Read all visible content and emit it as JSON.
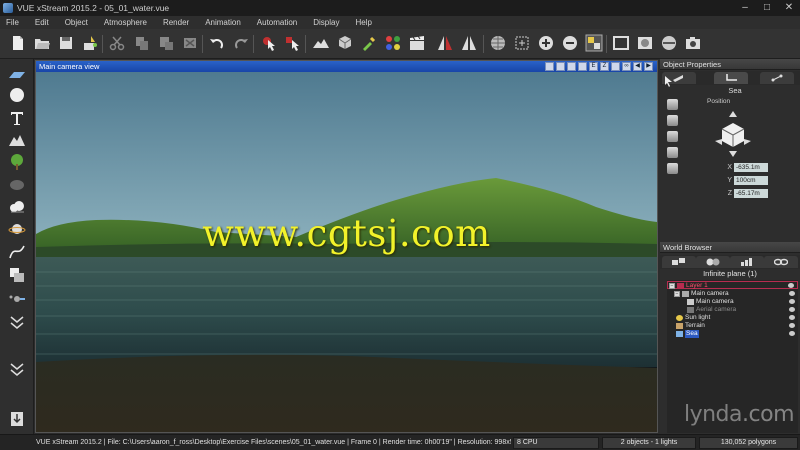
{
  "window": {
    "title": "VUE xStream 2015.2 - 05_01_water.vue",
    "controls": [
      "–",
      "□",
      "✕"
    ]
  },
  "menubar": {
    "items": [
      "File",
      "Edit",
      "Object",
      "Atmosphere",
      "Render",
      "Animation",
      "Automation",
      "Display",
      "Help"
    ]
  },
  "viewport": {
    "title": "Main camera view",
    "header_icons": [
      "E",
      "Z",
      "∞",
      "◀",
      "▶"
    ],
    "overlay_text": "www.cgtsj.com"
  },
  "object_properties": {
    "title": "Object Properties",
    "object_name": "Sea",
    "position_label": "Position",
    "coords": [
      {
        "axis": "X",
        "value": "-635.1m"
      },
      {
        "axis": "Y",
        "value": "100cm"
      },
      {
        "axis": "Z",
        "value": "-65.17m"
      }
    ]
  },
  "world_browser": {
    "title": "World Browser",
    "selected_label": "Infinite plane (1)",
    "tree": [
      {
        "label": "Layer 1",
        "kind": "layer",
        "indent": 0
      },
      {
        "label": "Main camera",
        "kind": "camera-group",
        "indent": 1
      },
      {
        "label": "Main camera",
        "kind": "camera",
        "indent": 2
      },
      {
        "label": "Aerial camera",
        "kind": "camera-dim",
        "indent": 2
      },
      {
        "label": "Sun light",
        "kind": "light",
        "indent": 1
      },
      {
        "label": "Terrain",
        "kind": "terrain",
        "indent": 1
      },
      {
        "label": "Sea",
        "kind": "sea-selected",
        "indent": 1
      }
    ]
  },
  "statusbar": {
    "main": "VUE xStream 2015.2 | File: C:\\Users\\aaron_f_ross\\Desktop\\Exercise Files\\scenes\\05_01_water.vue | Frame 0 | Render time: 0h00'19\" | Resolution: 998x562 | 130,052 polygons",
    "cpu": "8 CPU",
    "objects": "2 objects - 1 lights",
    "polygons": "130,052 polygons"
  },
  "watermark": {
    "brand": "lynda",
    "suffix": ".com"
  },
  "colors": {
    "viewport_header": "#1f4fb8",
    "overlay_text": "#f2f22a",
    "layer_highlight": "#ff4d6a",
    "selection": "#2c59c0"
  }
}
